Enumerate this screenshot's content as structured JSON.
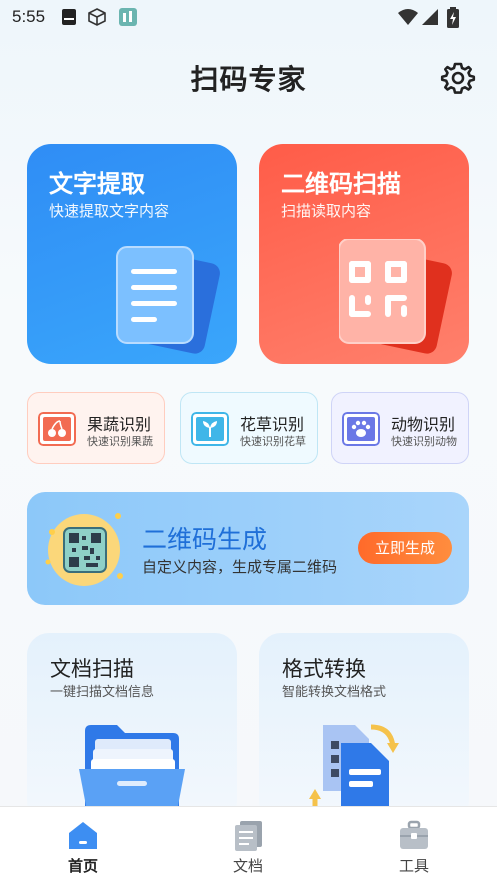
{
  "status_bar": {
    "time": "5:55"
  },
  "header": {
    "title": "扫码专家"
  },
  "cards": {
    "text_extract": {
      "title": "文字提取",
      "subtitle": "快速提取文字内容"
    },
    "qr_scan": {
      "title": "二维码扫描",
      "subtitle": "扫描读取内容"
    }
  },
  "small_cards": [
    {
      "title": "果蔬识别",
      "subtitle": "快速识别果蔬",
      "icon": "cherry-icon"
    },
    {
      "title": "花草识别",
      "subtitle": "快速识别花草",
      "icon": "sprout-icon"
    },
    {
      "title": "动物识别",
      "subtitle": "快速识别动物",
      "icon": "paw-icon"
    }
  ],
  "qr_generate": {
    "title": "二维码生成",
    "subtitle": "自定义内容，生成专属二维码",
    "button": "立即生成"
  },
  "bottom_cards": {
    "doc_scan": {
      "title": "文档扫描",
      "subtitle": "一键扫描文档信息"
    },
    "format_convert": {
      "title": "格式转换",
      "subtitle": "智能转换文档格式"
    }
  },
  "nav": [
    {
      "label": "首页",
      "icon": "home-icon",
      "active": true
    },
    {
      "label": "文档",
      "icon": "document-icon",
      "active": false
    },
    {
      "label": "工具",
      "icon": "toolbox-icon",
      "active": false
    }
  ],
  "colors": {
    "blue_card": "#2f8df5",
    "red_card": "#ff5c48",
    "accent_orange": "#ff6a2a",
    "nav_active": "#3d8ef2"
  }
}
